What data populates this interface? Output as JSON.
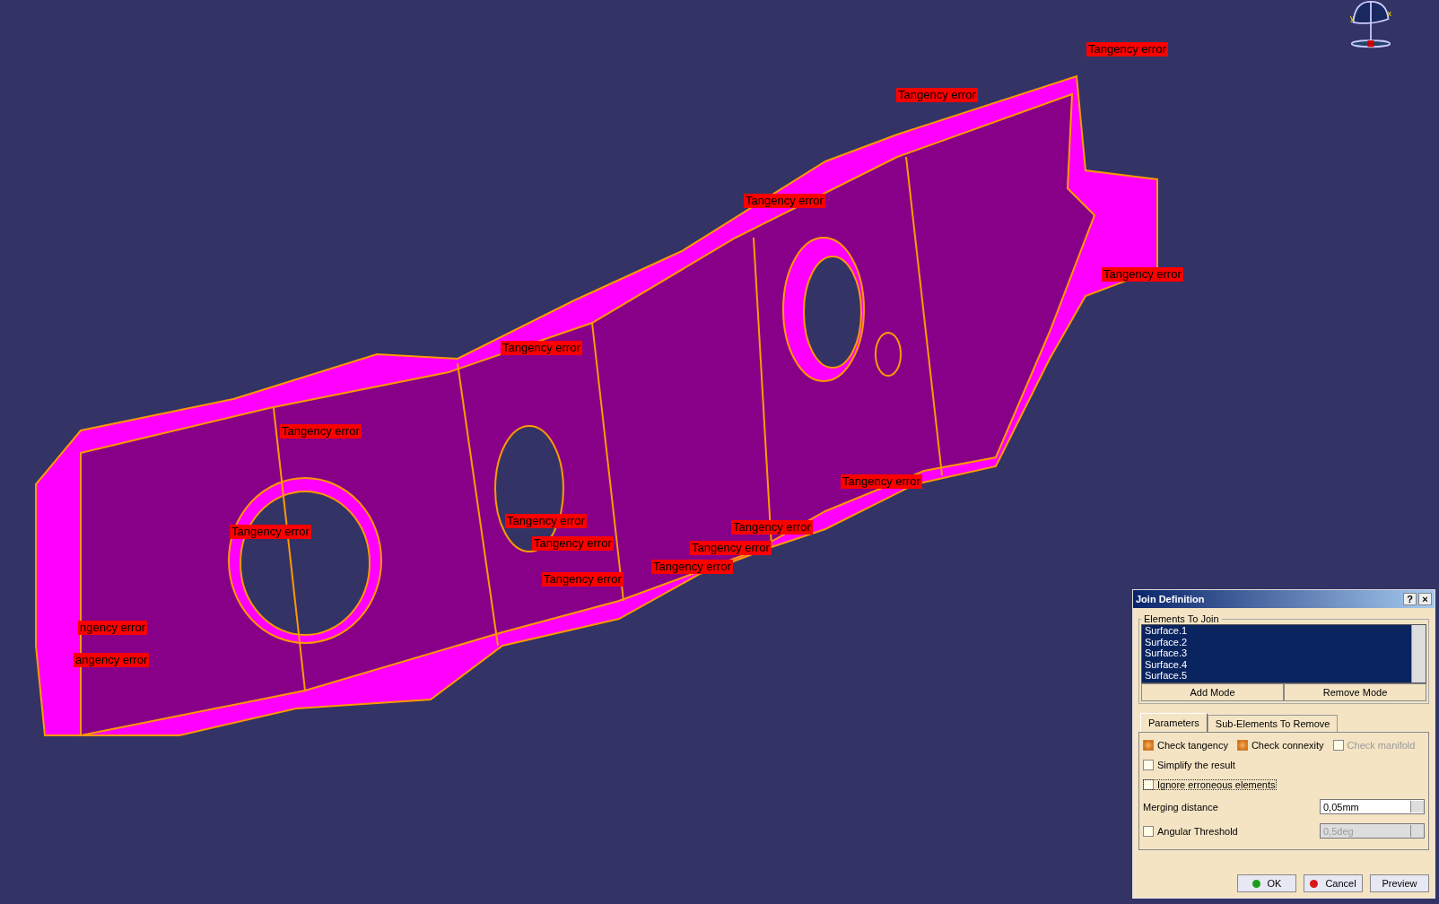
{
  "viewport": {
    "compass": {
      "axis_labels": [
        "y",
        "x"
      ]
    },
    "annotations": [
      {
        "text": "Tangency error"
      },
      {
        "text": "Tangency error"
      },
      {
        "text": "Tangency error"
      },
      {
        "text": "Tangency error"
      },
      {
        "text": "ngency error"
      },
      {
        "text": "angency error"
      },
      {
        "text": "Tangency error"
      },
      {
        "text": "Tangency error"
      },
      {
        "text": "Tangency error"
      },
      {
        "text": "Tangency error"
      },
      {
        "text": "Tangency error"
      },
      {
        "text": "Tangency error"
      },
      {
        "text": "Tangency error"
      },
      {
        "text": "Tangency error"
      },
      {
        "text": "Tangency error"
      },
      {
        "text": "Tangency error"
      }
    ]
  },
  "dialog": {
    "title": "Join Definition",
    "help": "?",
    "close": "×",
    "group_label": "Elements To Join",
    "elements": [
      {
        "label": "Surface.1",
        "selected": true
      },
      {
        "label": "Surface.2",
        "selected": true
      },
      {
        "label": "Surface.3",
        "selected": true
      },
      {
        "label": "Surface.4",
        "selected": true
      },
      {
        "label": "Surface.5",
        "selected": true
      }
    ],
    "mode_buttons": [
      "Add Mode",
      "Remove Mode"
    ],
    "tabs": [
      {
        "label": "Parameters",
        "selected": true
      },
      {
        "label": "Sub-Elements To Remove",
        "selected": false
      }
    ],
    "checks_row": [
      {
        "label": "Check tangency",
        "checked": true,
        "disabled": false
      },
      {
        "label": "Check connexity",
        "checked": true,
        "disabled": false
      },
      {
        "label": "Check manifold",
        "checked": false,
        "disabled": true
      }
    ],
    "options": [
      {
        "label": "Simplify the result",
        "checked": false
      },
      {
        "label": "Ignore erroneous elements",
        "checked": false
      }
    ],
    "merging": {
      "label": "Merging distance",
      "value": "0,05mm",
      "disabled": false
    },
    "angular": {
      "label": "Angular Threshold",
      "checked": false,
      "value": "0,5deg",
      "disabled": true
    },
    "buttons": [
      {
        "label": "OK",
        "kind": "ok"
      },
      {
        "label": "Cancel",
        "kind": "cancel"
      },
      {
        "label": "Preview",
        "kind": "plain"
      }
    ]
  }
}
